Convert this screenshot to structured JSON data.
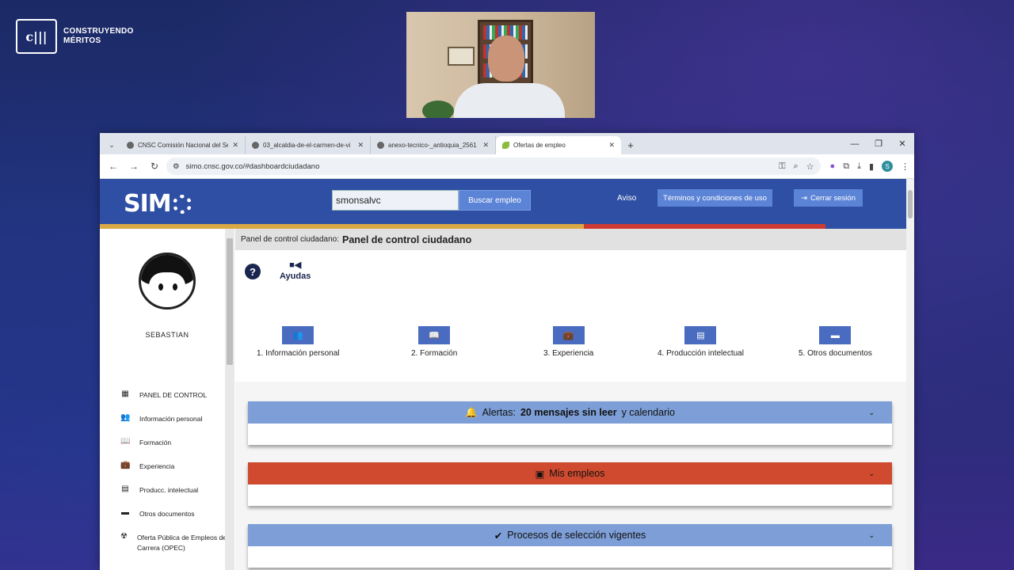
{
  "overlay": {
    "brand": {
      "logo": "c|||",
      "line1": "CONSTRUYENDO",
      "line2": "MÉRITOS"
    }
  },
  "browser": {
    "tabs": [
      {
        "title": "CNSC Comisión Nacional del Se",
        "icon": "cnsc-favicon"
      },
      {
        "title": "03_alcaldia-de-el-carmen-de-vi",
        "icon": "globe-icon"
      },
      {
        "title": "anexo-tecnico-_antioquia_2561",
        "icon": "globe-icon"
      },
      {
        "title": "Ofertas de empleo",
        "icon": "leaf-favicon"
      }
    ],
    "url": "simo.cnsc.gov.co/#dashboardciudadano",
    "profile_initial": "S"
  },
  "header": {
    "logo": "SIM",
    "search_value": "smonsalvc",
    "search_button": "Buscar empleo",
    "aviso": "Aviso",
    "terms": "Términos y condiciones de uso",
    "logout": "Cerrar sesión"
  },
  "sidebar": {
    "username": "SEBASTIAN",
    "items": [
      {
        "label": "PANEL DE CONTROL",
        "icon": "dashboard-icon"
      },
      {
        "label": "Información personal",
        "icon": "people-icon"
      },
      {
        "label": "Formación",
        "icon": "book-icon"
      },
      {
        "label": "Experiencia",
        "icon": "briefcase-icon"
      },
      {
        "label": "Producc. intelectual",
        "icon": "documents-icon"
      },
      {
        "label": "Otros documentos",
        "icon": "file-icon"
      },
      {
        "label": "Oferta Pública de Empleos de Carrera (OPEC)",
        "icon": "radiation-icon"
      }
    ]
  },
  "main": {
    "breadcrumb_prefix": "Panel de control ciudadano:",
    "breadcrumb_title": "Panel de control ciudadano",
    "help_label": "Ayudas",
    "steps": [
      {
        "label": "1. Información personal",
        "icon": "people-icon"
      },
      {
        "label": "2. Formación",
        "icon": "book-icon"
      },
      {
        "label": "3. Experiencia",
        "icon": "briefcase-icon"
      },
      {
        "label": "4. Producción intelectual",
        "icon": "documents-icon"
      },
      {
        "label": "5. Otros documentos",
        "icon": "file-icon"
      }
    ],
    "alerts": {
      "prefix": "Alertas:",
      "bold": "20 mensajes sin leer",
      "suffix": "y calendario"
    },
    "my_jobs": "Mis empleos",
    "processes": "Procesos de selección vigentes"
  },
  "colors": {
    "header_blue": "#2e4fa3",
    "card_blue": "#7d9ed6",
    "card_red": "#cf4a2f",
    "strip_yellow": "#d9a946",
    "strip_red": "#cf3b32"
  }
}
